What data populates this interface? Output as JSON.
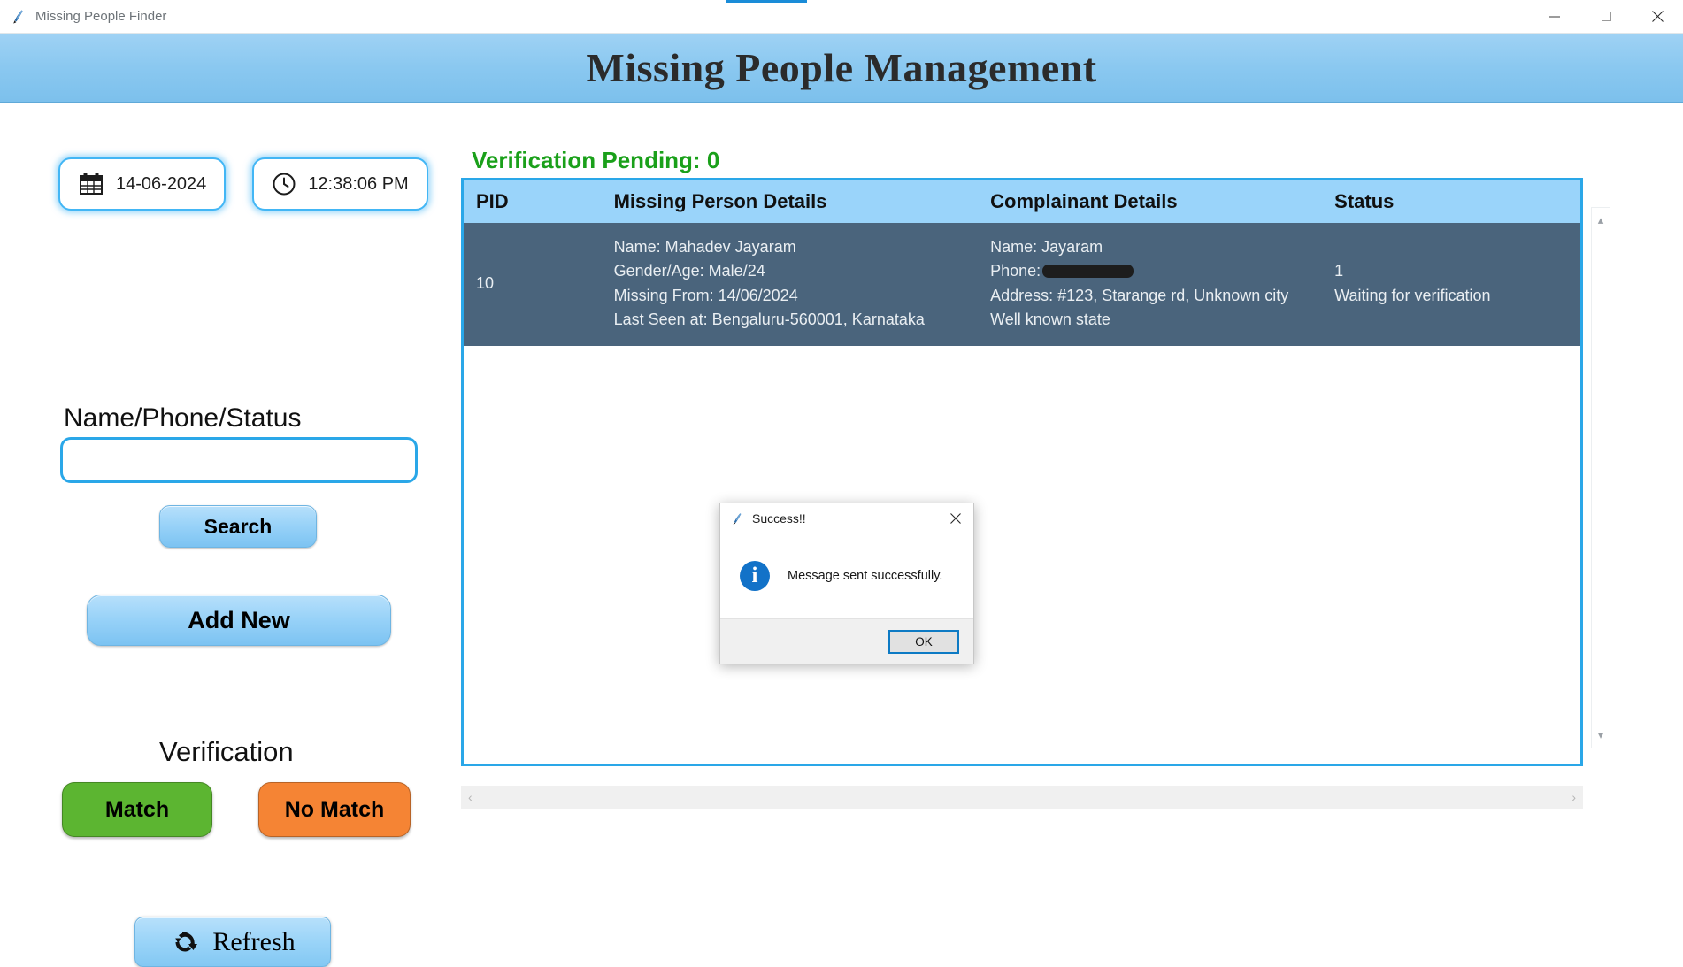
{
  "window": {
    "title": "Missing People Finder",
    "icon": "python-feather-icon",
    "minimize": "—",
    "maximize": "☐",
    "close": "✕"
  },
  "banner": {
    "title": "Missing People Management"
  },
  "sidebar": {
    "date": {
      "icon": "calendar-icon",
      "value": "14-06-2024"
    },
    "time": {
      "icon": "clock-icon",
      "value": "12:38:06 PM"
    },
    "search": {
      "label": "Name/Phone/Status",
      "value": "",
      "placeholder": "",
      "button": "Search"
    },
    "add_new_button": "Add New",
    "verification": {
      "label": "Verification",
      "match_button": "Match",
      "no_match_button": "No Match",
      "match_color": "#5cb531",
      "no_match_color": "#f58434"
    },
    "refresh_button": {
      "label": "Refresh",
      "icon": "refresh-icon"
    }
  },
  "content": {
    "pending_text": "Verification Pending: 0",
    "pending_color": "#1aa01a",
    "table": {
      "columns": [
        "PID",
        "Missing Person Details",
        "Complainant Details",
        "Status"
      ],
      "rows": [
        {
          "pid": "10",
          "selected": true,
          "missing_person": [
            "Name: Mahadev Jayaram",
            "Gender/Age: Male/24",
            "Missing From: 14/06/2024",
            "Last Seen at: Bengaluru-560001, Karnataka"
          ],
          "complainant": {
            "name": "Name: Jayaram",
            "phone_label": "Phone:",
            "phone_value": "",
            "phone_redacted": true,
            "address": "Address: #123, Starange rd, Unknown city",
            "address2": "Well known state"
          },
          "status": [
            "1",
            "Waiting for verification"
          ]
        }
      ]
    },
    "scrollbar": {
      "up": "▴",
      "down": "▾",
      "left": "‹",
      "right": "›"
    }
  },
  "dialog": {
    "title": "Success!!",
    "icon": "python-feather-icon",
    "close_icon": "close-icon",
    "info_icon": "info-icon",
    "info_glyph": "i",
    "message": "Message sent successfully.",
    "ok_button": "OK"
  }
}
